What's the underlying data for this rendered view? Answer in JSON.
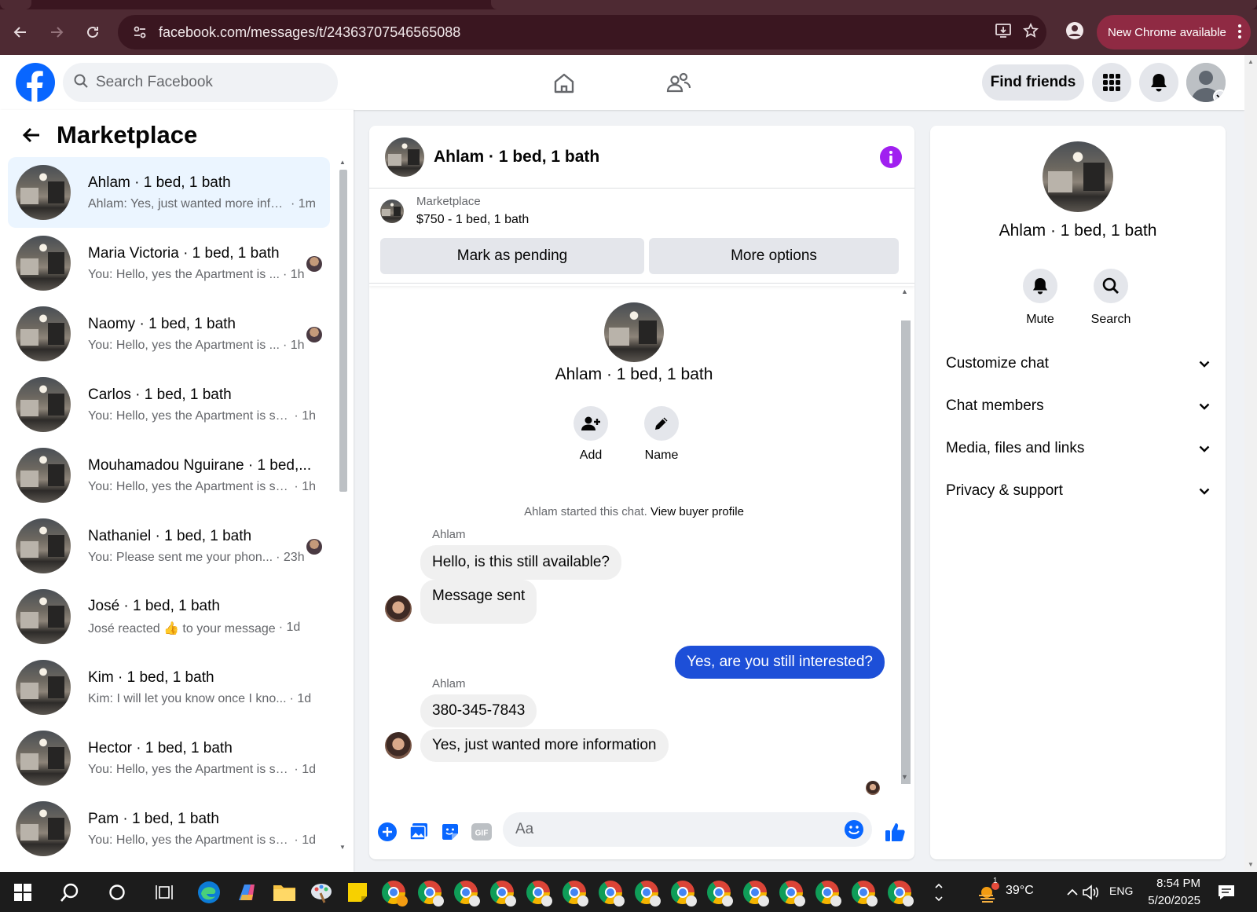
{
  "browser": {
    "url": "facebook.com/messages/t/24363707546565088",
    "update_label": "New Chrome available"
  },
  "header": {
    "search_placeholder": "Search Facebook",
    "find_friends_label": "Find friends"
  },
  "sidebar": {
    "title": "Marketplace",
    "conversations": [
      {
        "name": "Ahlam · 1 bed, 1 bath",
        "snippet": "Ahlam: Yes, just wanted more info...",
        "time": "· 1m",
        "active": true,
        "seen": false
      },
      {
        "name": "Maria Victoria · 1 bed, 1 bath",
        "snippet": "You: Hello, yes the Apartment is ...",
        "time": "· 1h",
        "active": false,
        "seen": true
      },
      {
        "name": "Naomy · 1 bed, 1 bath",
        "snippet": "You: Hello, yes the Apartment is ...",
        "time": "· 1h",
        "active": false,
        "seen": true
      },
      {
        "name": "Carlos · 1 bed, 1 bath",
        "snippet": "You: Hello, yes the Apartment is stil...",
        "time": "· 1h",
        "active": false,
        "seen": false
      },
      {
        "name": "Mouhamadou Nguirane · 1 bed,...",
        "snippet": "You: Hello, yes the Apartment is stil...",
        "time": "· 1h",
        "active": false,
        "seen": false
      },
      {
        "name": "Nathaniel · 1 bed, 1 bath",
        "snippet": "You: Please sent me your phon...",
        "time": "· 23h",
        "active": false,
        "seen": true
      },
      {
        "name": "José · 1 bed, 1 bath",
        "snippet": "José reacted 👍 to your message",
        "time": "· 1d",
        "active": false,
        "seen": false
      },
      {
        "name": "Kim · 1 bed, 1 bath",
        "snippet": "Kim: I will let you know once I kno...",
        "time": "· 1d",
        "active": false,
        "seen": false
      },
      {
        "name": "Hector · 1 bed, 1 bath",
        "snippet": "You: Hello, yes the Apartment is stil...",
        "time": "· 1d",
        "active": false,
        "seen": false
      },
      {
        "name": "Pam · 1 bed, 1 bath",
        "snippet": "You: Hello, yes the Apartment is stil...",
        "time": "· 1d",
        "active": false,
        "seen": false
      }
    ]
  },
  "chat": {
    "title": "Ahlam · 1 bed, 1 bath",
    "marketplace_label": "Marketplace",
    "listing": "$750 - 1 bed, 1 bath",
    "mark_pending_label": "Mark as pending",
    "more_options_label": "More options",
    "intro_name": "Ahlam · 1 bed, 1 bath",
    "add_label": "Add",
    "name_label": "Name",
    "started_text": "Ahlam started this chat.",
    "view_profile_label": "View buyer profile",
    "sender_name": "Ahlam",
    "messages": [
      {
        "from": "Ahlam",
        "text": "Hello, is this still available?"
      },
      {
        "from": "Ahlam",
        "text": "Message sent"
      },
      {
        "from": "me",
        "text": "Yes, are you still interested?"
      },
      {
        "from": "Ahlam",
        "text": "380-345-7843"
      },
      {
        "from": "Ahlam",
        "text": "Yes, just wanted more information"
      }
    ],
    "composer_placeholder": "Aa"
  },
  "info_panel": {
    "name": "Ahlam · 1 bed, 1 bath",
    "mute_label": "Mute",
    "search_label": "Search",
    "sections": [
      "Customize chat",
      "Chat members",
      "Media, files and links",
      "Privacy & support"
    ]
  },
  "taskbar": {
    "temperature": "39°C",
    "language": "ENG",
    "time": "8:54 PM",
    "date": "5/20/2025",
    "weather_badge": "1"
  },
  "colors": {
    "fb_blue": "#0866ff",
    "my_bubble": "#1d4fd8",
    "info_purple": "#a020f0",
    "chrome_frame": "#4e2a33"
  }
}
